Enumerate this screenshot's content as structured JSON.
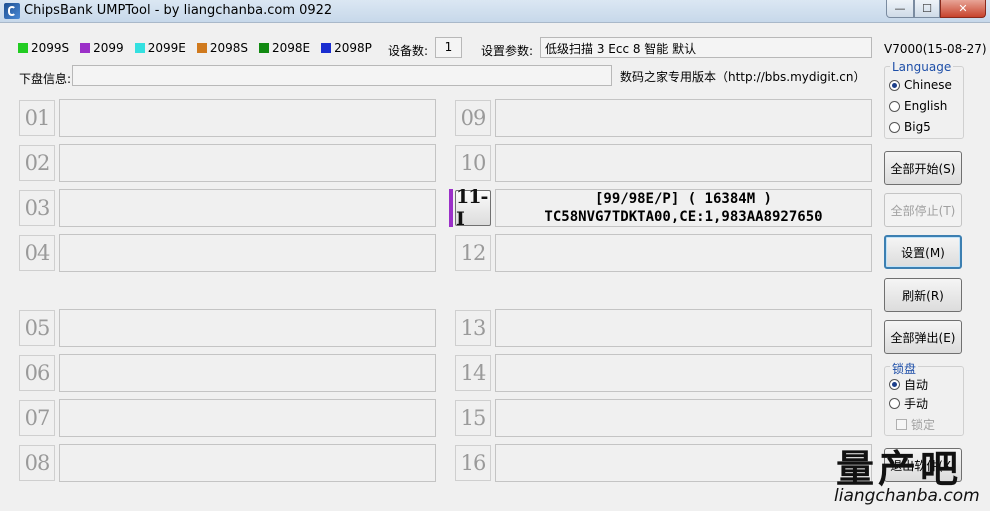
{
  "window": {
    "title": "ChipsBank UMPTool - by liangchanba.com 0922",
    "controls": {
      "minimize": "—",
      "maximize": "☐",
      "close": "✕"
    }
  },
  "legend": [
    {
      "label": "2099S",
      "color": "#22cc22"
    },
    {
      "label": "2099",
      "color": "#9b30c8"
    },
    {
      "label": "2099E",
      "color": "#33e0e0"
    },
    {
      "label": "2098S",
      "color": "#d07a1e"
    },
    {
      "label": "2098E",
      "color": "#128a12"
    },
    {
      "label": "2098P",
      "color": "#1a2ed0"
    }
  ],
  "device_count": {
    "label": "设备数:",
    "value": "1"
  },
  "settings": {
    "label": "设置参数:",
    "value": "低级扫描 3 Ecc 8 智能 默认"
  },
  "version": "V7000(15-08-27)",
  "disk_info": {
    "label": "下盘信息:",
    "value": "",
    "note": "数码之家专用版本（http://bbs.mydigit.cn）"
  },
  "slots_left": [
    {
      "num": "01"
    },
    {
      "num": "02"
    },
    {
      "num": "03"
    },
    {
      "num": "04"
    },
    {
      "num": "05"
    },
    {
      "num": "06"
    },
    {
      "num": "07"
    },
    {
      "num": "08"
    }
  ],
  "slots_right": [
    {
      "num": "09"
    },
    {
      "num": "10"
    },
    {
      "num": "11-I",
      "line1": "[99/98E/P] ( 16384M )",
      "line2": "TC58NVG7TDKTA00,CE:1,983AA8927650"
    },
    {
      "num": "12"
    },
    {
      "num": "13"
    },
    {
      "num": "14"
    },
    {
      "num": "15"
    },
    {
      "num": "16"
    }
  ],
  "language": {
    "title": "Language",
    "options": [
      {
        "label": "Chinese",
        "checked": true
      },
      {
        "label": "English",
        "checked": false
      },
      {
        "label": "Big5",
        "checked": false
      }
    ]
  },
  "buttons": {
    "start_all": "全部开始(S)",
    "stop_all": "全部停止(T)",
    "settings": "设置(M)",
    "refresh": "刷新(R)",
    "eject_all": "全部弹出(E)",
    "exit": "退出软件(X)"
  },
  "lock": {
    "title": "锁盘",
    "auto": "自动",
    "manual": "手动",
    "lock": "锁定"
  },
  "watermark": {
    "name": "量产吧",
    "url": "liangchanba.com"
  }
}
